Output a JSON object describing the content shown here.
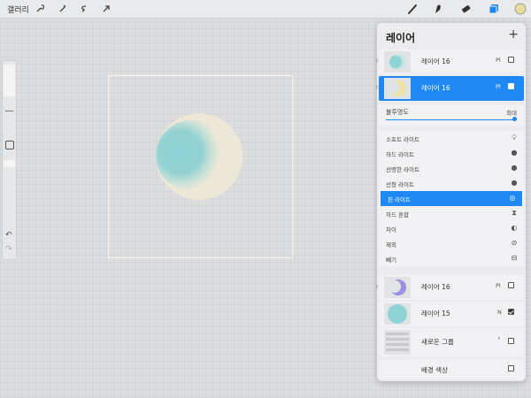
{
  "topbar": {
    "gallery_label": "갤러리",
    "left_tools": [
      "wrench-icon",
      "magic-wand-icon",
      "selection-s-icon",
      "transform-arrow-icon"
    ],
    "right_tools": [
      "brush-icon",
      "smudge-icon",
      "eraser-icon",
      "layers-icon",
      "color-swatch-icon"
    ],
    "accent_color": "#1e88f5",
    "swatch_color": "#e8dca0"
  },
  "sidebar": {
    "undo_icon": "undo-icon",
    "redo_icon": "redo-icon"
  },
  "layers_panel": {
    "title": "레이어",
    "add_icon": "+",
    "layers": [
      {
        "name": "레이어 16",
        "blend": "Pl",
        "visible": false
      },
      {
        "name": "레이어 16",
        "blend": "Pl",
        "visible": true,
        "selected": true
      },
      {
        "name": "레이어 16",
        "blend": "Pl",
        "visible": false
      },
      {
        "name": "레이어 15",
        "blend": "N",
        "visible": true
      }
    ],
    "opacity": {
      "label": "불투명도",
      "value": "최대",
      "level": 1.0
    },
    "blend_modes": [
      {
        "label": "소프트 라이트",
        "icon": "bulb"
      },
      {
        "label": "하드 라이트",
        "icon": "bulb"
      },
      {
        "label": "선명한 라이트",
        "icon": "bulb"
      },
      {
        "label": "선형 라이트",
        "icon": "bulb"
      },
      {
        "label": "핀 라이트",
        "icon": "bulb",
        "selected": true
      },
      {
        "label": "하드 혼합",
        "icon": "mix"
      },
      {
        "label": "차이",
        "icon": "half"
      },
      {
        "label": "제외",
        "icon": "slash"
      },
      {
        "label": "빼기",
        "icon": "minus"
      }
    ],
    "group": {
      "name": "새로운 그룹",
      "visible": false
    },
    "background": {
      "name": "배경 색상",
      "visible": false
    }
  }
}
